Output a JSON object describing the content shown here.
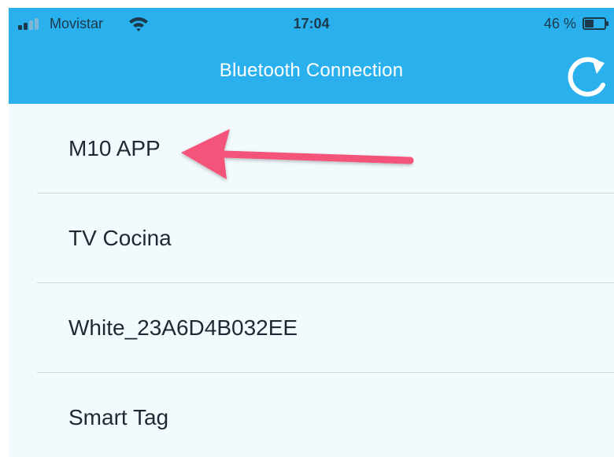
{
  "status_bar": {
    "carrier": "Movistar",
    "time": "17:04",
    "battery": "46 %",
    "battery_level": 0.46
  },
  "nav": {
    "title": "Bluetooth Connection",
    "refresh_icon": "refresh-icon"
  },
  "devices": [
    {
      "label": "M10 APP"
    },
    {
      "label": "TV Cocina"
    },
    {
      "label": "White_23A6D4B032EE"
    },
    {
      "label": "Smart Tag"
    }
  ],
  "annotation": {
    "arrow_color": "#f4527a",
    "points_to": "M10 APP"
  },
  "colors": {
    "header": "#2bb0ee",
    "background": "#f2fafd"
  }
}
